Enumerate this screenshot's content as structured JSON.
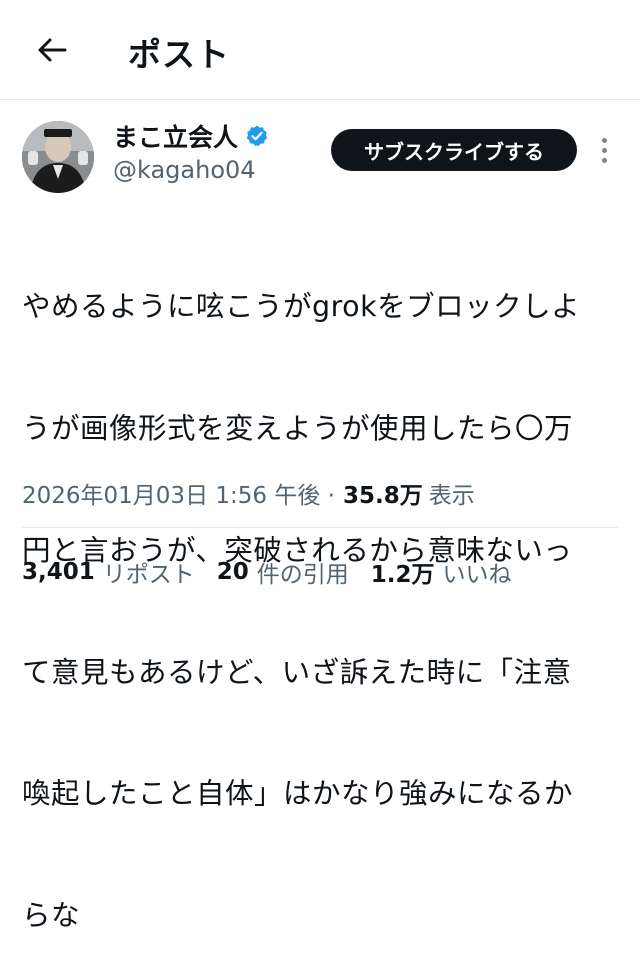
{
  "header": {
    "title": "ポスト",
    "back_icon": "arrow-left-icon"
  },
  "author": {
    "display_name": "まこ立会人",
    "handle": "@kagaho04",
    "verified_icon": "verified-badge-icon",
    "verified_color": "#1d9bf0"
  },
  "subscribe_label": "サブスクライブする",
  "tweet": {
    "lines": [
      "やめるように呟こうがgrokをブロックしよ",
      "うが画像形式を変えようが使用したら〇万",
      "円と言おうが、突破されるから意味ないっ",
      "て意見もあるけど、いざ訴えた時に「注意",
      "喚起したこと自体」はかなり強みになるか",
      "らな"
    ]
  },
  "meta": {
    "datetime": "2026年01月03日 1:56 午後 · ",
    "views": "35.8万",
    "views_label": "表示"
  },
  "stats": {
    "reposts_count": "3,401",
    "reposts_label": "リポスト",
    "quotes_count": "20",
    "quotes_label": "件の引用",
    "likes_count": "1.2万",
    "likes_label": "いいね"
  }
}
